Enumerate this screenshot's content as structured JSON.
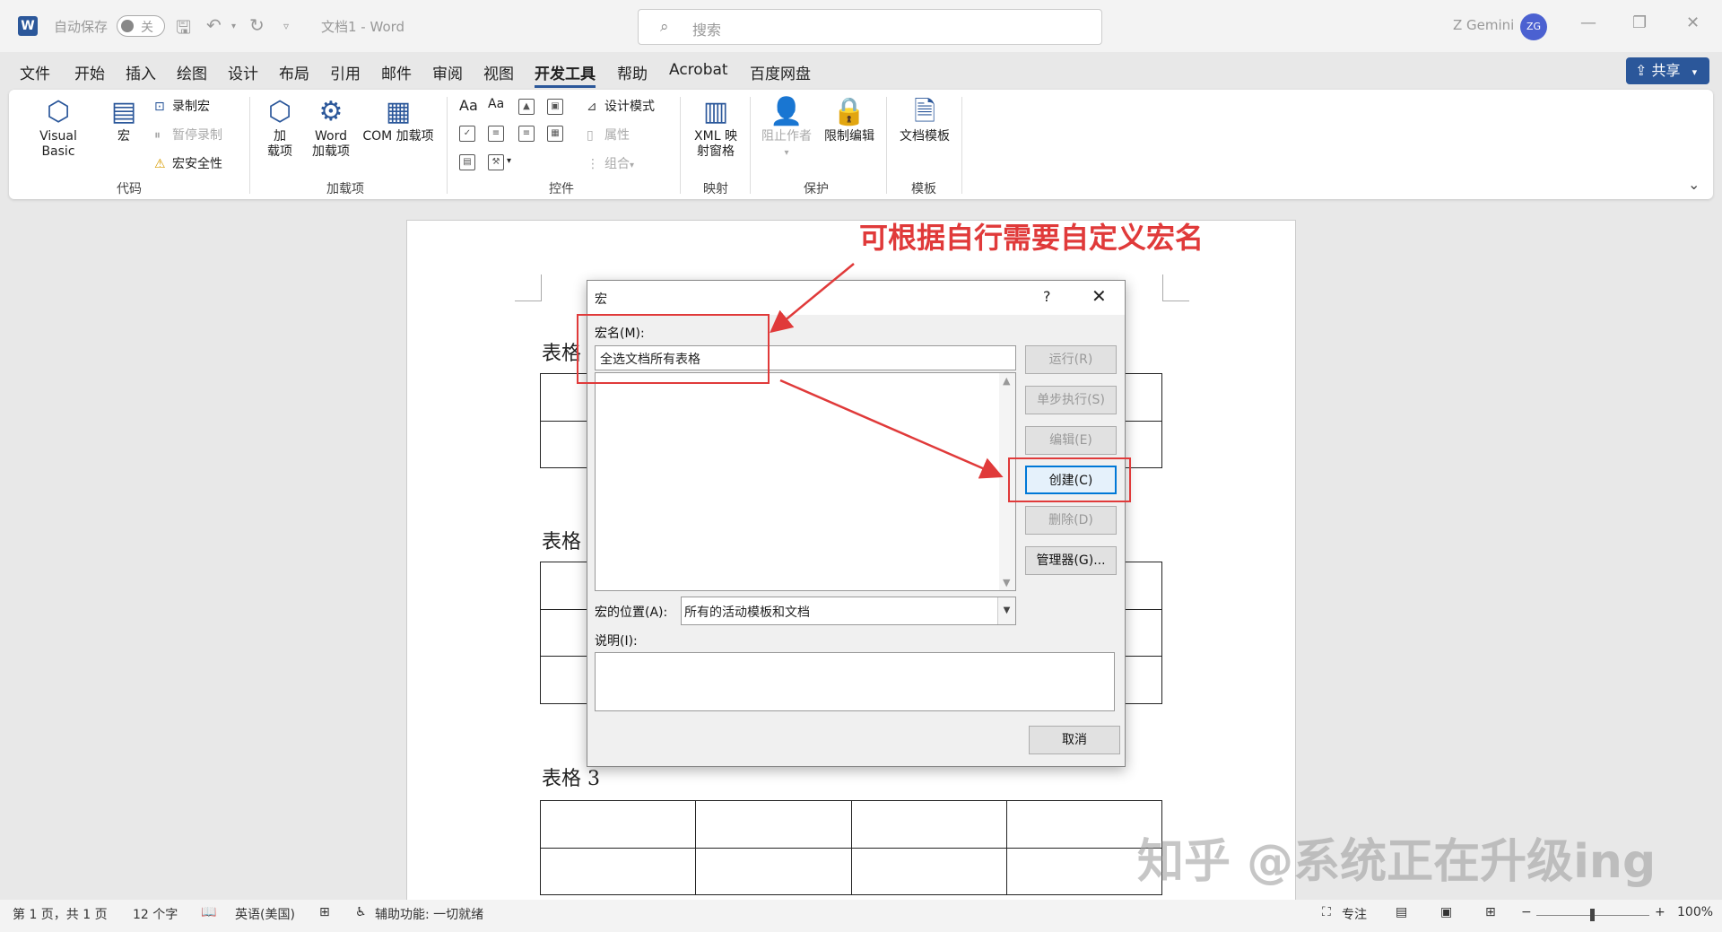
{
  "titlebar": {
    "logo": "W",
    "autosave_label": "自动保存",
    "autosave_state": "关",
    "doc_title": "文档1  -  Word",
    "search_placeholder": "搜索",
    "user_name": "Z Gemini",
    "avatar": "ZG",
    "icons": [
      "save-icon",
      "undo-icon",
      "redo-icon",
      "customize-icon",
      "minimize-icon",
      "restore-icon",
      "close-icon"
    ]
  },
  "tabs": [
    "文件",
    "开始",
    "插入",
    "绘图",
    "设计",
    "布局",
    "引用",
    "邮件",
    "审阅",
    "视图",
    "开发工具",
    "帮助",
    "Acrobat",
    "百度网盘"
  ],
  "active_tab": "开发工具",
  "share_label": "共享",
  "ribbon": {
    "code": {
      "label": "代码",
      "visual_basic": "Visual Basic",
      "macro": "宏",
      "record": "录制宏",
      "pause": "暂停录制",
      "security": "宏安全性"
    },
    "addins": {
      "label": "加载项",
      "addin_1": "加",
      "addin_2": "载项",
      "word_addin_1": "Word",
      "word_addin_2": "加载项",
      "com": "COM 加载项"
    },
    "controls": {
      "label": "控件",
      "design_mode": "设计模式",
      "properties": "属性",
      "group": "组合",
      "aa1": "Aa",
      "aa2": "Aa"
    },
    "mapping": {
      "label": "映射",
      "xml_1": "XML 映",
      "xml_2": "射窗格"
    },
    "protect": {
      "label": "保护",
      "block_authors": "阻止作者",
      "restrict": "限制编辑"
    },
    "templates": {
      "label": "模板",
      "doc_template": "文档模板"
    }
  },
  "document": {
    "table_titles": [
      "表格",
      "表格",
      "表格 3"
    ]
  },
  "dialog": {
    "title": "宏",
    "help": "?",
    "close": "✕",
    "name_label": "宏名(M):",
    "name_value": "全选文档所有表格",
    "buttons": {
      "run": "运行(R)",
      "step": "单步执行(S)",
      "edit": "编辑(E)",
      "create": "创建(C)",
      "delete": "删除(D)",
      "organizer": "管理器(G)...",
      "cancel": "取消"
    },
    "location_label": "宏的位置(A):",
    "location_value": "所有的活动模板和文档",
    "desc_label": "说明(I):"
  },
  "annotation": {
    "text": "可根据自行需要自定义宏名",
    "color": "#e03a3a"
  },
  "watermark": "知乎 @系统正在升级ing",
  "statusbar": {
    "page": "第 1 页，共 1 页",
    "words": "12 个字",
    "language": "英语(美国)",
    "accessibility": "辅助功能: 一切就绪",
    "focus": "专注",
    "zoom": "100%"
  },
  "colors": {
    "accent": "#2b579a",
    "annotation": "#e03a3a"
  }
}
